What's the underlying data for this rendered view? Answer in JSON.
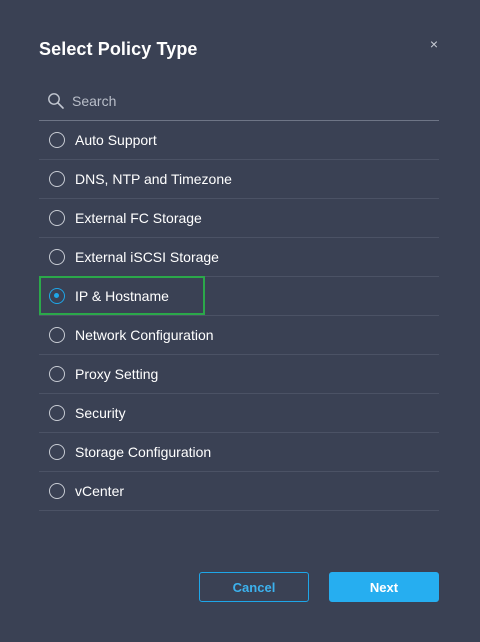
{
  "dialog": {
    "title": "Select Policy Type",
    "close_glyph": "×"
  },
  "search": {
    "placeholder": "Search",
    "value": "",
    "icon": "search-icon"
  },
  "policies": [
    {
      "label": "Auto Support",
      "selected": false
    },
    {
      "label": "DNS, NTP and Timezone",
      "selected": false
    },
    {
      "label": "External FC Storage",
      "selected": false
    },
    {
      "label": "External iSCSI Storage",
      "selected": false
    },
    {
      "label": "IP & Hostname",
      "selected": true
    },
    {
      "label": "Network Configuration",
      "selected": false
    },
    {
      "label": "Proxy Setting",
      "selected": false
    },
    {
      "label": "Security",
      "selected": false
    },
    {
      "label": "Storage Configuration",
      "selected": false
    },
    {
      "label": "vCenter",
      "selected": false
    }
  ],
  "footer": {
    "cancel_label": "Cancel",
    "next_label": "Next"
  },
  "colors": {
    "background": "#3a4154",
    "accent": "#1ea6e8",
    "highlight": "#2ba84a",
    "text": "#ffffff"
  }
}
